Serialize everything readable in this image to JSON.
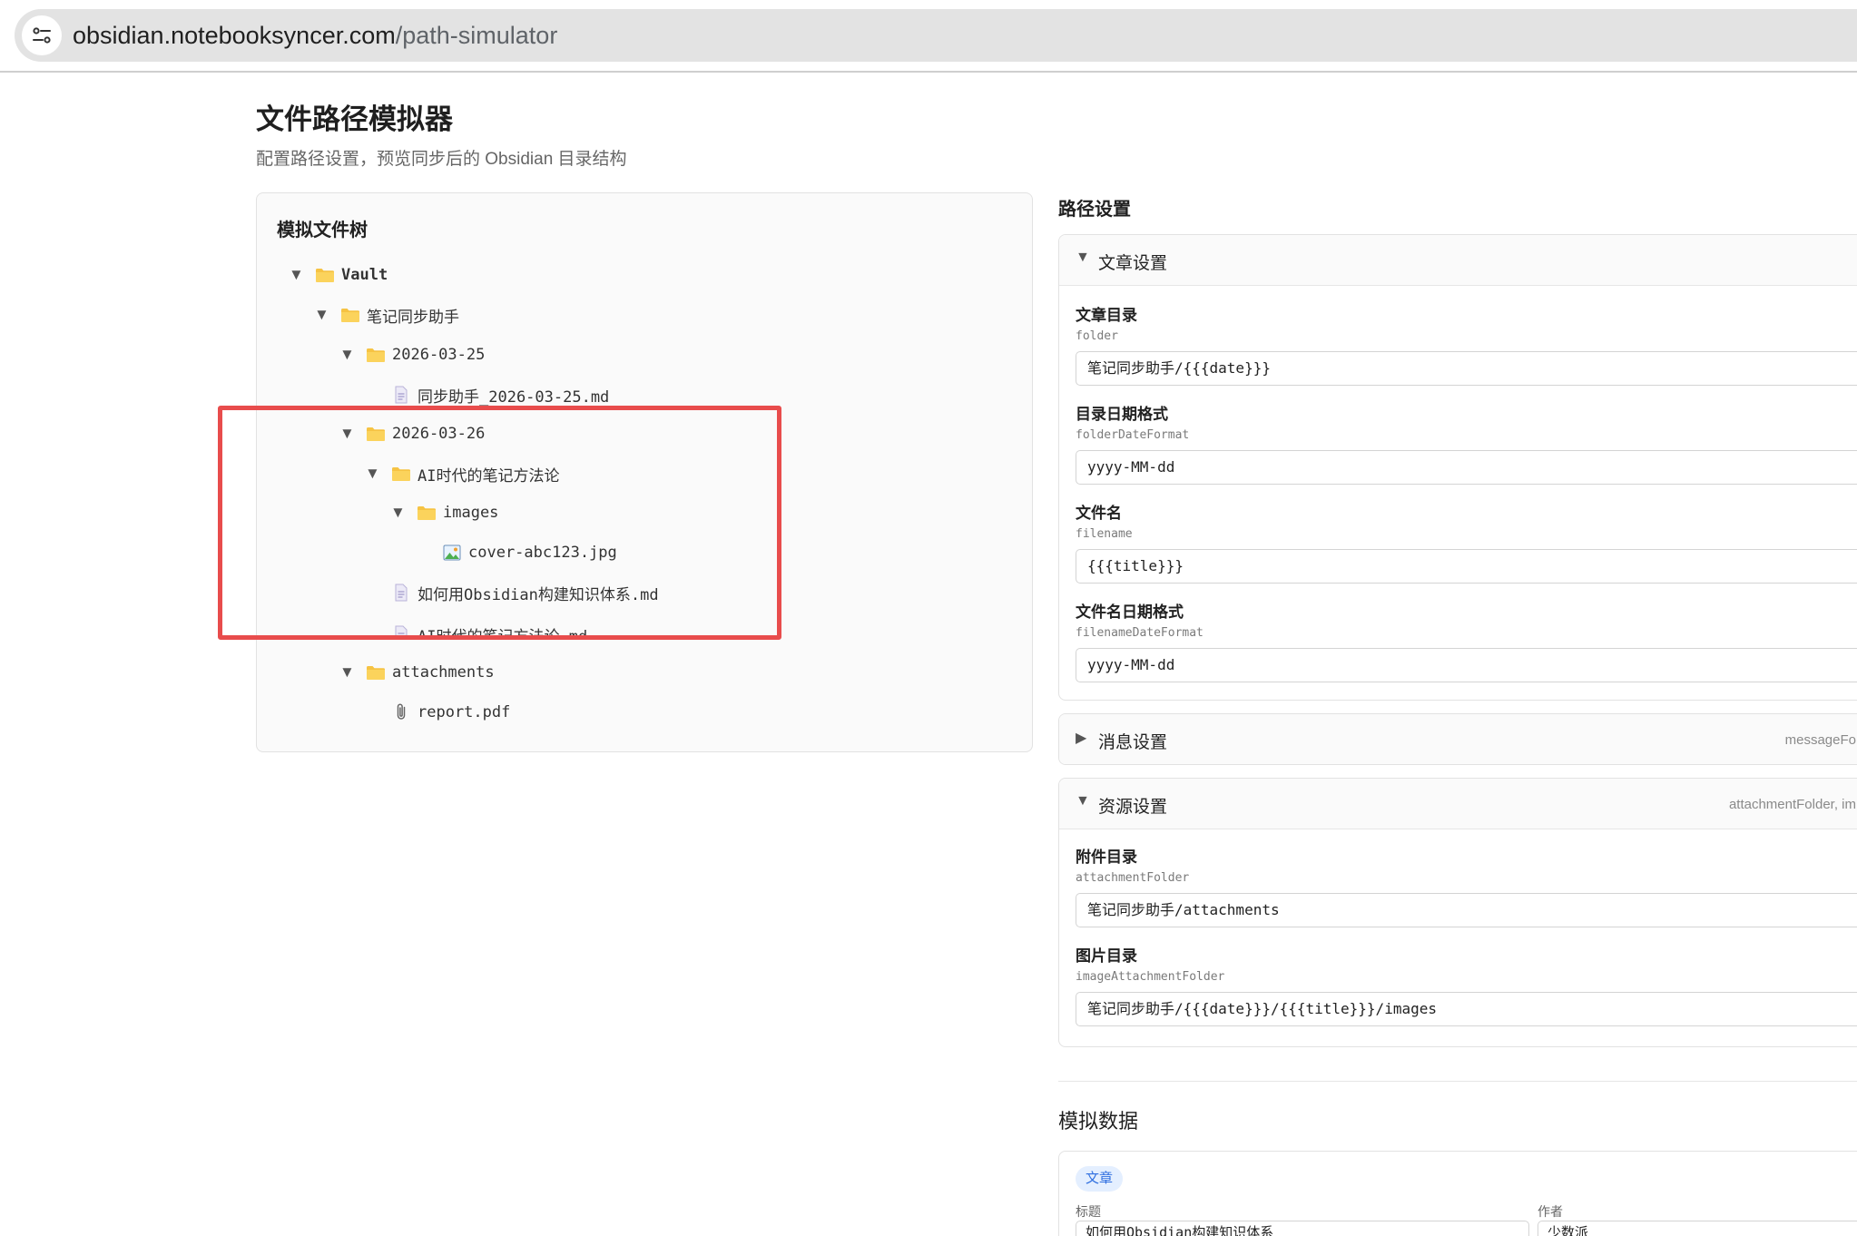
{
  "browser": {
    "url_host": "obsidian.notebooksyncer.com",
    "url_path": "/path-simulator"
  },
  "header": {
    "title": "文件路径模拟器",
    "subtitle": "配置路径设置，预览同步后的 Obsidian 目录结构"
  },
  "tree": {
    "title": "模拟文件树",
    "nodes": [
      {
        "label": "Vault",
        "kind": "folder",
        "expanded": true
      },
      {
        "label": "笔记同步助手",
        "kind": "folder",
        "expanded": true
      },
      {
        "label": "2026-03-25",
        "kind": "folder",
        "expanded": true
      },
      {
        "label": "同步助手_2026-03-25.md",
        "kind": "md-file"
      },
      {
        "label": "2026-03-26",
        "kind": "folder",
        "expanded": true
      },
      {
        "label": "AI时代的笔记方法论",
        "kind": "folder",
        "expanded": true
      },
      {
        "label": "images",
        "kind": "folder",
        "expanded": true
      },
      {
        "label": "cover-abc123.jpg",
        "kind": "image-file"
      },
      {
        "label": "如何用Obsidian构建知识体系.md",
        "kind": "md-file"
      },
      {
        "label": "AI时代的笔记方法论.md",
        "kind": "md-file"
      },
      {
        "label": "attachments",
        "kind": "folder",
        "expanded": true
      },
      {
        "label": "report.pdf",
        "kind": "attachment-file"
      }
    ],
    "toggle_expanded": "▼",
    "toggle_collapsed": "▶"
  },
  "settings": {
    "heading": "路径设置",
    "article": {
      "title": "文章设置",
      "fields": [
        {
          "label": "文章目录",
          "key": "folder",
          "value": "笔记同步助手/{{{date}}}"
        },
        {
          "label": "目录日期格式",
          "key": "folderDateFormat",
          "value": "yyyy-MM-dd"
        },
        {
          "label": "文件名",
          "key": "filename",
          "value": "{{{title}}}"
        },
        {
          "label": "文件名日期格式",
          "key": "filenameDateFormat",
          "value": "yyyy-MM-dd"
        }
      ]
    },
    "message": {
      "title": "消息设置",
      "hint": "messageFo"
    },
    "resource": {
      "title": "资源设置",
      "hint": "attachmentFolder, im",
      "fields": [
        {
          "label": "附件目录",
          "key": "attachmentFolder",
          "value": "笔记同步助手/attachments"
        },
        {
          "label": "图片目录",
          "key": "imageAttachmentFolder",
          "value": "笔记同步助手/{{{date}}}/{{{title}}}/images"
        }
      ]
    }
  },
  "mock": {
    "heading": "模拟数据",
    "chip": "文章",
    "title_label": "标题",
    "title_value": "如何用Obsidian构建知识体系",
    "author_label": "作者",
    "author_value": "少数派"
  },
  "colors": {
    "highlight": "#e84c4c",
    "folder": "#f6c343",
    "chip_bg": "#e4efff",
    "chip_text": "#2f6fe0"
  }
}
